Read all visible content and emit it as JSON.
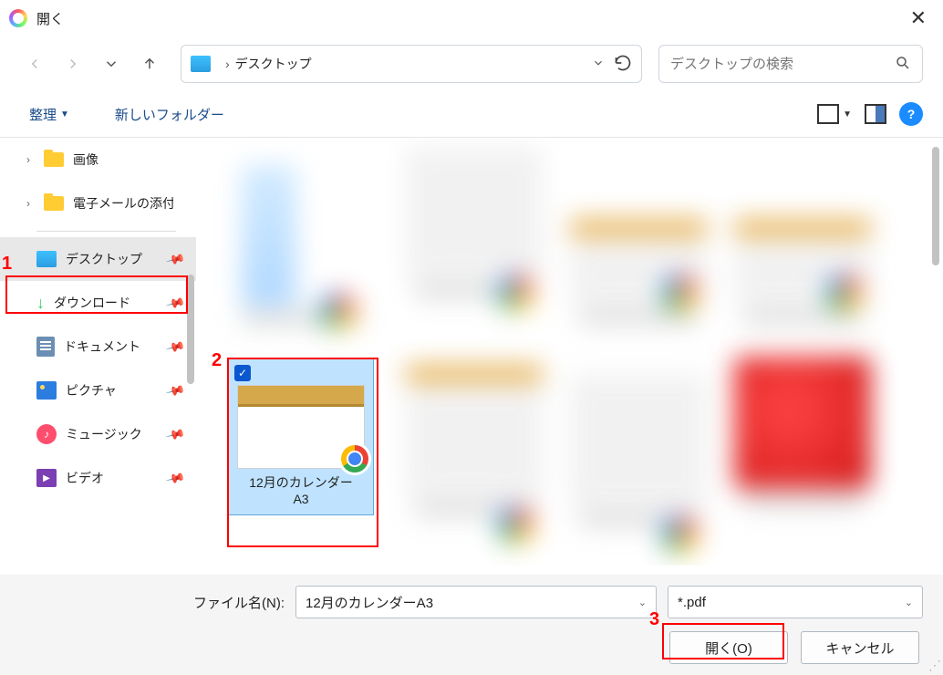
{
  "window": {
    "title": "開く"
  },
  "breadcrumb": {
    "location": "デスクトップ"
  },
  "search": {
    "placeholder": "デスクトップの検索"
  },
  "toolbar": {
    "organize": "整理",
    "new_folder": "新しいフォルダー"
  },
  "tree": {
    "images": "画像",
    "email_attach": "電子メールの添付",
    "desktop": "デスクトップ",
    "downloads": "ダウンロード",
    "documents": "ドキュメント",
    "pictures": "ピクチャ",
    "music": "ミュージック",
    "videos": "ビデオ"
  },
  "selected_file": {
    "name_line1": "12月のカレンダー",
    "name_line2": "A3"
  },
  "filename_row": {
    "label": "ファイル名(N):",
    "value": "12月のカレンダーA3"
  },
  "filter": {
    "value": "*.pdf"
  },
  "buttons": {
    "open": "開く(O)",
    "cancel": "キャンセル"
  },
  "annotations": {
    "n1": "1",
    "n2": "2",
    "n3": "3"
  }
}
